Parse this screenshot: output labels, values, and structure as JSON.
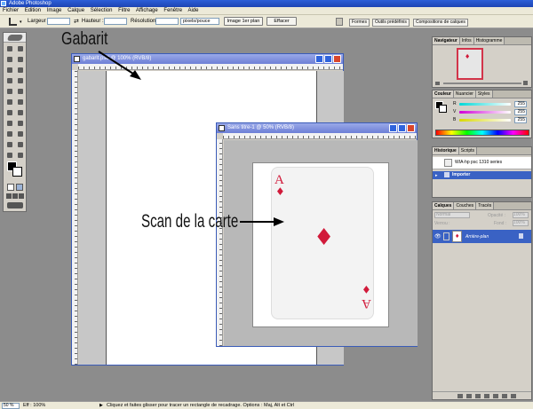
{
  "app": {
    "title": "Adobe Photoshop"
  },
  "menu": [
    "Fichier",
    "Edition",
    "Image",
    "Calque",
    "Sélection",
    "Filtre",
    "Affichage",
    "Fenêtre",
    "Aide"
  ],
  "options": {
    "width_label": "Largeur :",
    "height_label": "Hauteur :",
    "resolution_label": "Résolution :",
    "resolution_unit": "pixels/pouce",
    "front_image_button": "Image 1er plan",
    "clear_button": "Effacer",
    "palette_well_tabs": [
      "Formes",
      "Outils prédéfinis",
      "Compositions de calques"
    ]
  },
  "doc_gabarit": {
    "title": "gabarit.psd @ 100% (RVB/8)"
  },
  "doc_scan": {
    "title": "Sans titre-1 @ 50% (RVB/8)"
  },
  "card": {
    "rank": "A",
    "suit": "♦"
  },
  "annotations": {
    "gabarit": "Gabarit",
    "scan": "Scan de la carte"
  },
  "navigator": {
    "tabs": [
      "Navigateur",
      "Infos",
      "Histogramme"
    ]
  },
  "color": {
    "tabs": [
      "Couleur",
      "Nuancier",
      "Styles"
    ],
    "channels": [
      {
        "name": "R",
        "value": "255"
      },
      {
        "name": "V",
        "value": "255"
      },
      {
        "name": "B",
        "value": "255"
      }
    ]
  },
  "history": {
    "tabs": [
      "Historique",
      "Scripts"
    ],
    "items": [
      "WIA-hp psc 1310 series",
      "Importer"
    ]
  },
  "layers": {
    "tabs": [
      "Calques",
      "Couches",
      "Tracés"
    ],
    "blend_mode": "Normal",
    "opacity_label": "Opacité :",
    "opacity": "100%",
    "lock_label": "Verrou :",
    "fill_label": "Fond :",
    "fill": "100%",
    "items": [
      {
        "name": "Arrière-plan"
      }
    ]
  },
  "status": {
    "zoom": "50 %",
    "doc_info": "Eff : 100%",
    "hint": "Cliquez et faites glisser pour tracer un rectangle de recadrage. Options : Maj, Alt et Ctrl"
  }
}
